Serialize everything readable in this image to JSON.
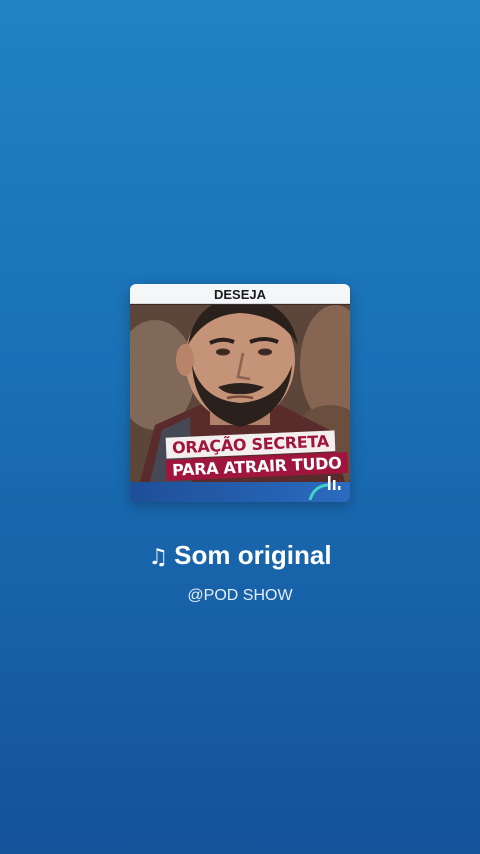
{
  "cover": {
    "top_label": "DESEJA",
    "banner_line1": "ORAÇÃO SECRETA",
    "banner_line2": "PARA ATRAIR TUDO"
  },
  "sound": {
    "note_icon": "♫",
    "title": "Som original",
    "handle": "@POD SHOW"
  },
  "colors": {
    "background_top": "#1f83c2",
    "background_bottom": "#14529a",
    "banner_accent": "#a0153e"
  }
}
